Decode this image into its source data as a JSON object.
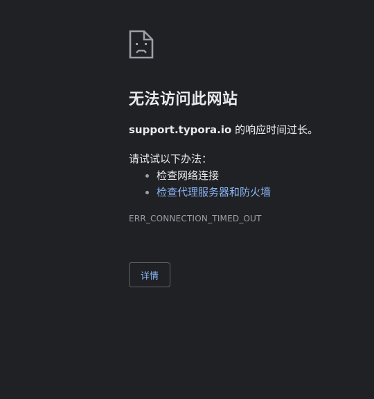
{
  "icon": "sad-page-icon",
  "colors": {
    "background": "#202124",
    "text": "#e8eaed",
    "muted": "#9aa0a6",
    "link": "#8ab4f8",
    "button_border": "#5f6368"
  },
  "error": {
    "title": "无法访问此网站",
    "host": "support.typora.io",
    "message_suffix": " 的响应时间过长。",
    "try_heading": "请试试以下办法：",
    "suggestions": [
      {
        "text": "检查网络连接",
        "is_link": false
      },
      {
        "text": "检查代理服务器和防火墙",
        "is_link": true
      }
    ],
    "code": "ERR_CONNECTION_TIMED_OUT",
    "details_label": "详情"
  }
}
